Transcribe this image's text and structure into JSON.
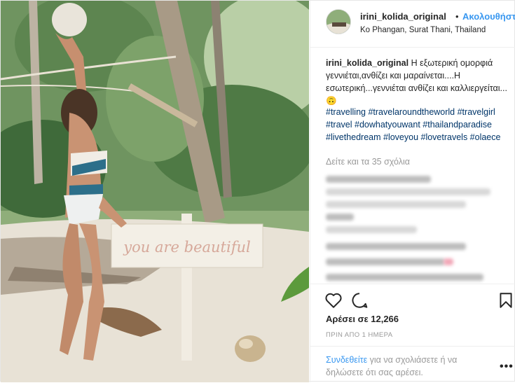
{
  "header": {
    "username": "irini_kolida_original",
    "separator": "•",
    "follow_label": "Ακολουθήστε",
    "location": "Ko Phangan, Surat Thani, Thailand"
  },
  "photo": {
    "sign_text": "you are beautiful"
  },
  "caption": {
    "username": "irini_kolida_original",
    "text": "Η εξωτερική ομορφιά γεννιέται,ανθίζει και μαραίνεται....Η εσωτερική...γεννιέται ανθίζει και καλλιεργείται... 🙃",
    "hashtags": "#travelling #travelaroundtheworld #travelgirl #travel #dowhatyouwant #thailandparadise #livethedream #loveyou #lovetravels #olaece"
  },
  "comments": {
    "view_all": "Δείτε και τα 35 σχόλια"
  },
  "actions": {
    "like_icon": "heart-icon",
    "comment_icon": "comment-icon",
    "save_icon": "bookmark-icon"
  },
  "likes": {
    "label": "Αρέσει σε 12,266"
  },
  "timestamp": "ΠΡΙΝ ΑΠΟ 1 ΗΜΕΡΑ",
  "login_prompt": {
    "link": "Συνδεθείτε",
    "rest": " για να σχολιάσετε ή να δηλώσετε ότι σας αρέσει."
  },
  "more_label": "•••",
  "colors": {
    "link_blue": "#3897f0",
    "hashtag_blue": "#003569",
    "muted": "#999999",
    "text": "#262626",
    "border": "#efefef"
  }
}
